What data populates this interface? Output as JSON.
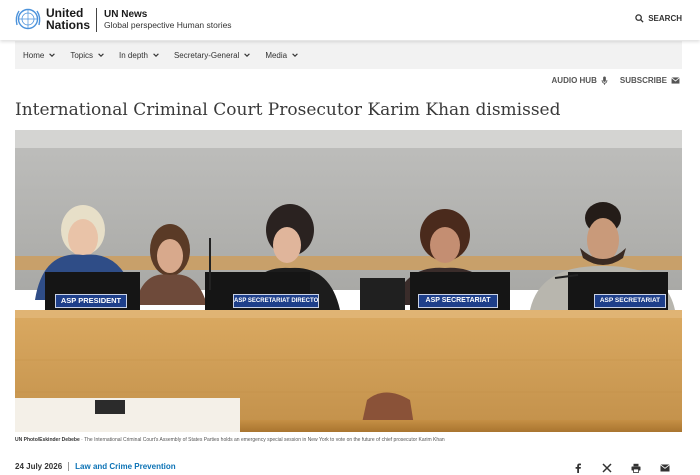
{
  "header": {
    "logo_line1": "United",
    "logo_line2": "Nations",
    "site_title": "UN News",
    "tagline": "Global perspective Human stories",
    "search_label": "SEARCH"
  },
  "nav": {
    "items": [
      {
        "label": "Home"
      },
      {
        "label": "Topics"
      },
      {
        "label": "In depth"
      },
      {
        "label": "Secretary-General"
      },
      {
        "label": "Media"
      }
    ]
  },
  "utility": {
    "audio_hub": "AUDIO HUB",
    "subscribe": "SUBSCRIBE"
  },
  "article": {
    "headline": "International Criminal Court Prosecutor Karim Khan dismissed",
    "photo": {
      "nameplates": [
        "ASP PRESIDENT",
        "ASP SECRETARIAT DIRECTOR",
        "ASP SECRETARIAT",
        "ASP SECRETARIAT"
      ]
    },
    "caption_credit": "UN Photo/Eskinder Debebe",
    "caption_text": "The International Criminal Court's Assembly of States Parties holds an emergency special session in New York to vote on the future of chief prosecutor Karim Khan",
    "date": "24 July 2026",
    "topic": "Law and Crime Prevention"
  },
  "colors": {
    "accent": "#0b72b5",
    "nav_bg": "#f2f2f2",
    "nameplate_bg": "#1e3f8a"
  },
  "icons": [
    "un-emblem-icon",
    "search-icon",
    "chevron-down-icon",
    "microphone-icon",
    "envelope-icon",
    "facebook-icon",
    "x-icon",
    "print-icon",
    "email-icon"
  ]
}
